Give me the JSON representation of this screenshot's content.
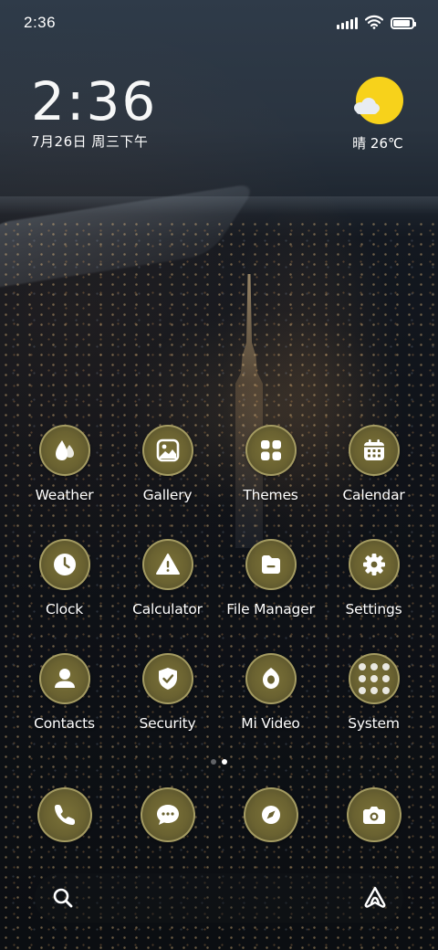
{
  "status_bar": {
    "time": "2:36",
    "icons": [
      "signal-icon",
      "wifi-icon",
      "battery-icon"
    ],
    "battery_level": 0.9
  },
  "clock_widget": {
    "time": "2:36",
    "date": "7月26日 周三下午"
  },
  "weather_widget": {
    "icon": "sun-cloud-icon",
    "text": "晴 26℃"
  },
  "apps": [
    {
      "label": "Weather",
      "icon": "weather-drops-icon"
    },
    {
      "label": "Gallery",
      "icon": "gallery-icon"
    },
    {
      "label": "Themes",
      "icon": "themes-icon"
    },
    {
      "label": "Calendar",
      "icon": "calendar-icon"
    },
    {
      "label": "Clock",
      "icon": "clock-icon"
    },
    {
      "label": "Calculator",
      "icon": "calculator-icon"
    },
    {
      "label": "File Manager",
      "icon": "file-manager-icon"
    },
    {
      "label": "Settings",
      "icon": "settings-gear-icon"
    },
    {
      "label": "Contacts",
      "icon": "contacts-icon"
    },
    {
      "label": "Security",
      "icon": "security-shield-icon"
    },
    {
      "label": "Mi Video",
      "icon": "mi-video-icon"
    },
    {
      "label": "System",
      "icon": "system-folder-icon"
    }
  ],
  "page_indicator": {
    "pages": 2,
    "active": 2
  },
  "dock": [
    {
      "icon": "phone-icon"
    },
    {
      "icon": "messages-icon"
    },
    {
      "icon": "browser-compass-icon"
    },
    {
      "icon": "camera-icon"
    }
  ],
  "search_bar": {
    "left_icon": "search-icon",
    "right_icon": "assistant-icon"
  },
  "colors": {
    "icon_fill": "#6a6231",
    "icon_ring": "#dcd28c",
    "sun": "#f7d21b",
    "text": "#ffffff"
  }
}
